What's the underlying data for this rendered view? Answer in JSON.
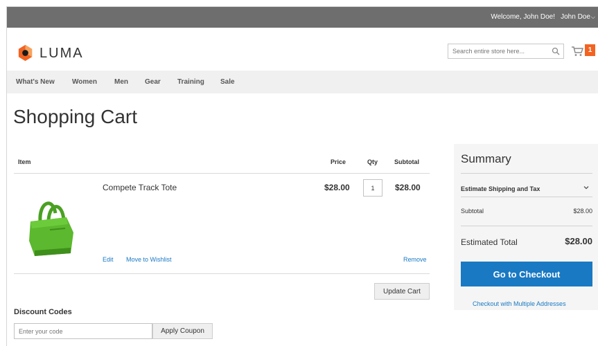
{
  "header": {
    "welcome": "Welcome, John Doe!",
    "account_name": "John Doe",
    "logo_text": "LUMA",
    "search_placeholder": "Search entire store here...",
    "cart_count": "1"
  },
  "nav": {
    "items": [
      "What's New",
      "Women",
      "Men",
      "Gear",
      "Training",
      "Sale"
    ]
  },
  "page": {
    "title": "Shopping Cart"
  },
  "cart": {
    "columns": {
      "item": "Item",
      "price": "Price",
      "qty": "Qty",
      "subtotal": "Subtotal"
    },
    "items": [
      {
        "name": "Compete Track Tote",
        "price": "$28.00",
        "qty": "1",
        "subtotal": "$28.00",
        "edit_label": "Edit",
        "wishlist_label": "Move to Wishlist",
        "remove_label": "Remove"
      }
    ],
    "update_label": "Update Cart"
  },
  "discount": {
    "title": "Discount Codes",
    "placeholder": "Enter your code",
    "apply_label": "Apply Coupon"
  },
  "summary": {
    "title": "Summary",
    "estimate_shipping": "Estimate Shipping and Tax",
    "subtotal_label": "Subtotal",
    "subtotal_value": "$28.00",
    "est_total_label": "Estimated Total",
    "est_total_value": "$28.00",
    "checkout_label": "Go to Checkout",
    "multi_address_label": "Checkout with Multiple Addresses"
  },
  "colors": {
    "accent": "#1979c3",
    "cart_badge": "#f26322",
    "topbar": "#6e6e6e",
    "product": "#5cb82e"
  }
}
